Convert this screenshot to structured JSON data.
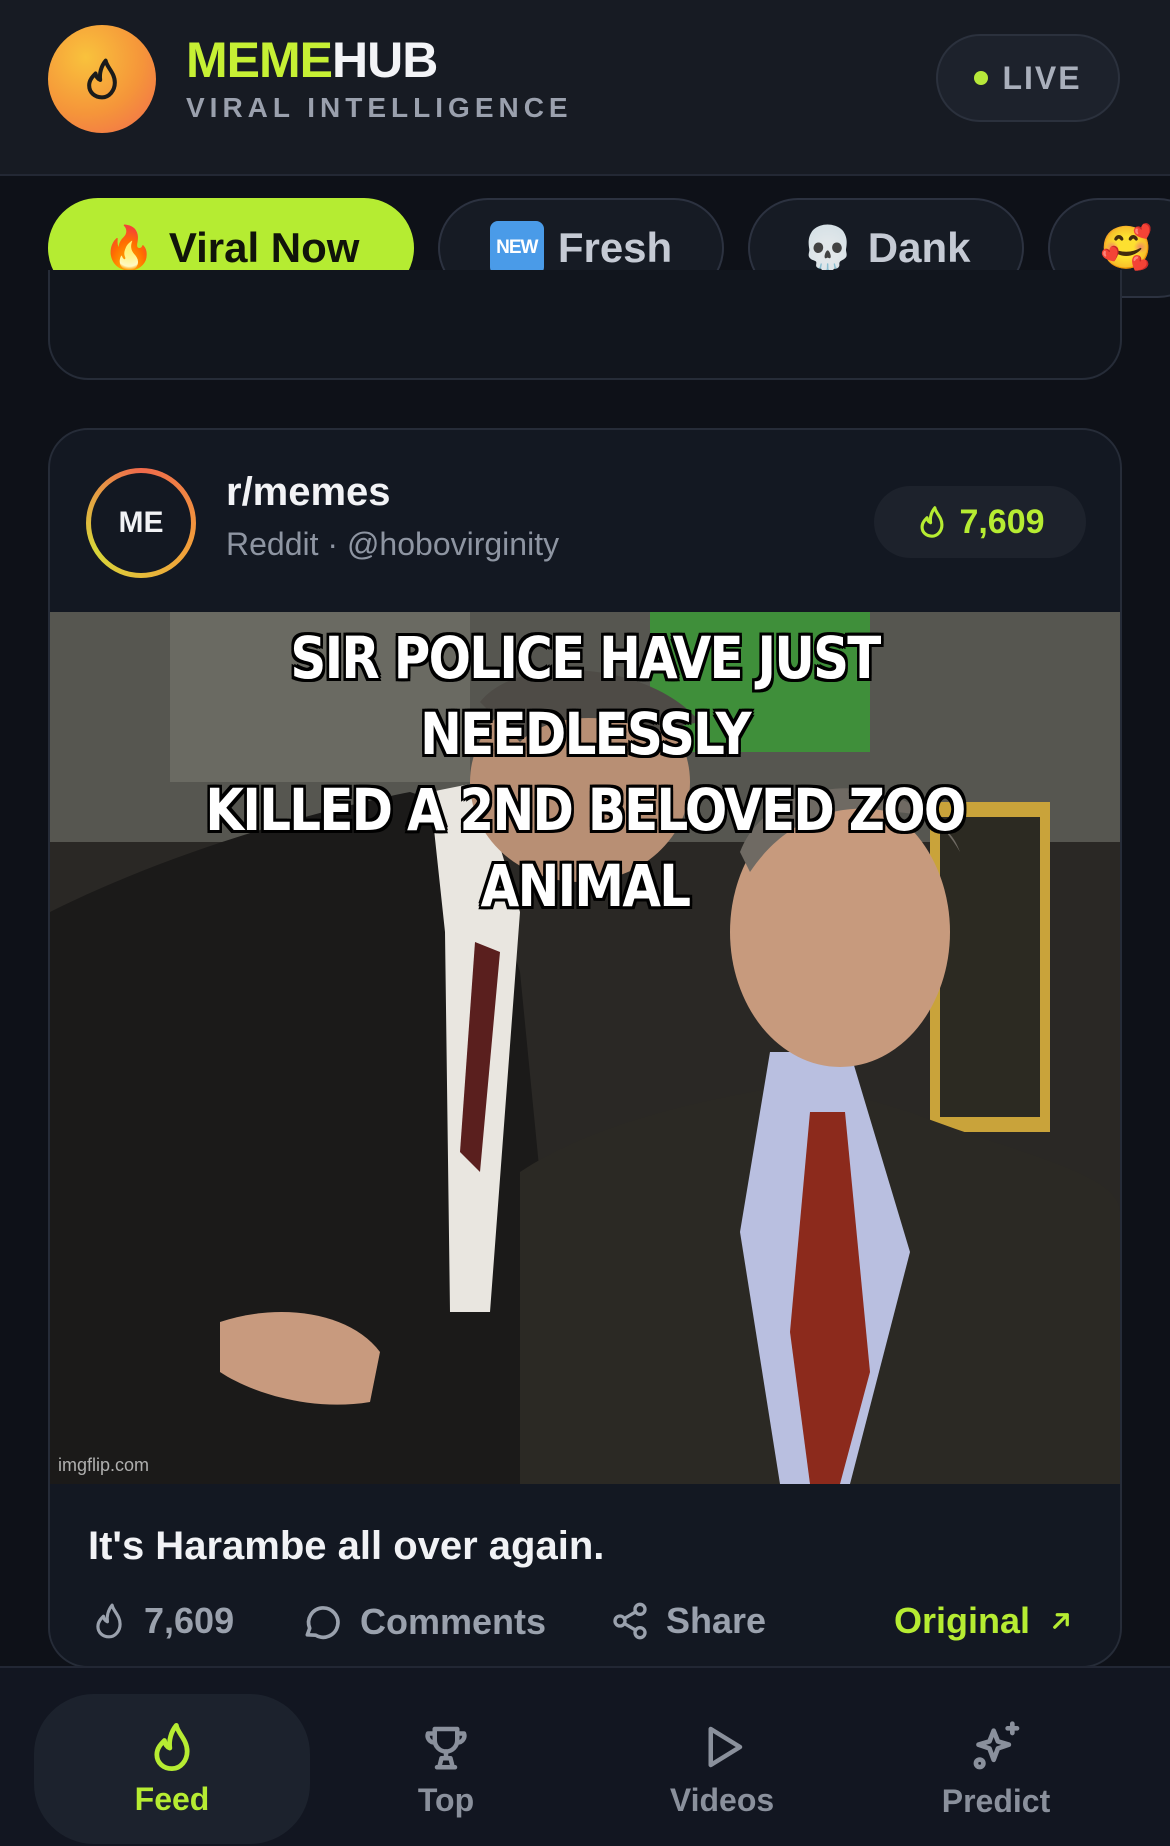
{
  "header": {
    "brand_a": "MEME",
    "brand_b": "HUB",
    "tagline": "VIRAL INTELLIGENCE",
    "live_label": "LIVE",
    "accent": "#b5ec32"
  },
  "filters": [
    {
      "icon": "fire-emoji",
      "emoji": "🔥",
      "label": "Viral Now",
      "active": true
    },
    {
      "icon": "new-badge",
      "badge": "NEW",
      "label": "Fresh",
      "active": false
    },
    {
      "icon": "skull-emoji",
      "emoji": "💀",
      "label": "Dank",
      "active": false
    },
    {
      "icon": "smiling-hearts-emoji",
      "emoji": "🥰",
      "label": "",
      "active": false
    }
  ],
  "post": {
    "avatar_initials": "ME",
    "subreddit": "r/memes",
    "meta": "Reddit · @hobovirginity",
    "score": "7,609",
    "meme_caption_line1": "SIR POLICE HAVE JUST NEEDLESSLY",
    "meme_caption_line2": "KILLED A 2ND BELOVED ZOO ANIMAL",
    "watermark": "imgflip.com",
    "title": "It's Harambe all over again.",
    "actions": {
      "score": "7,609",
      "comments": "Comments",
      "share": "Share",
      "original": "Original"
    }
  },
  "nav": [
    {
      "label": "Feed",
      "icon": "flame-icon",
      "active": true
    },
    {
      "label": "Top",
      "icon": "trophy-icon",
      "active": false
    },
    {
      "label": "Videos",
      "icon": "play-icon",
      "active": false
    },
    {
      "label": "Predict",
      "icon": "sparkle-icon",
      "active": false
    }
  ]
}
